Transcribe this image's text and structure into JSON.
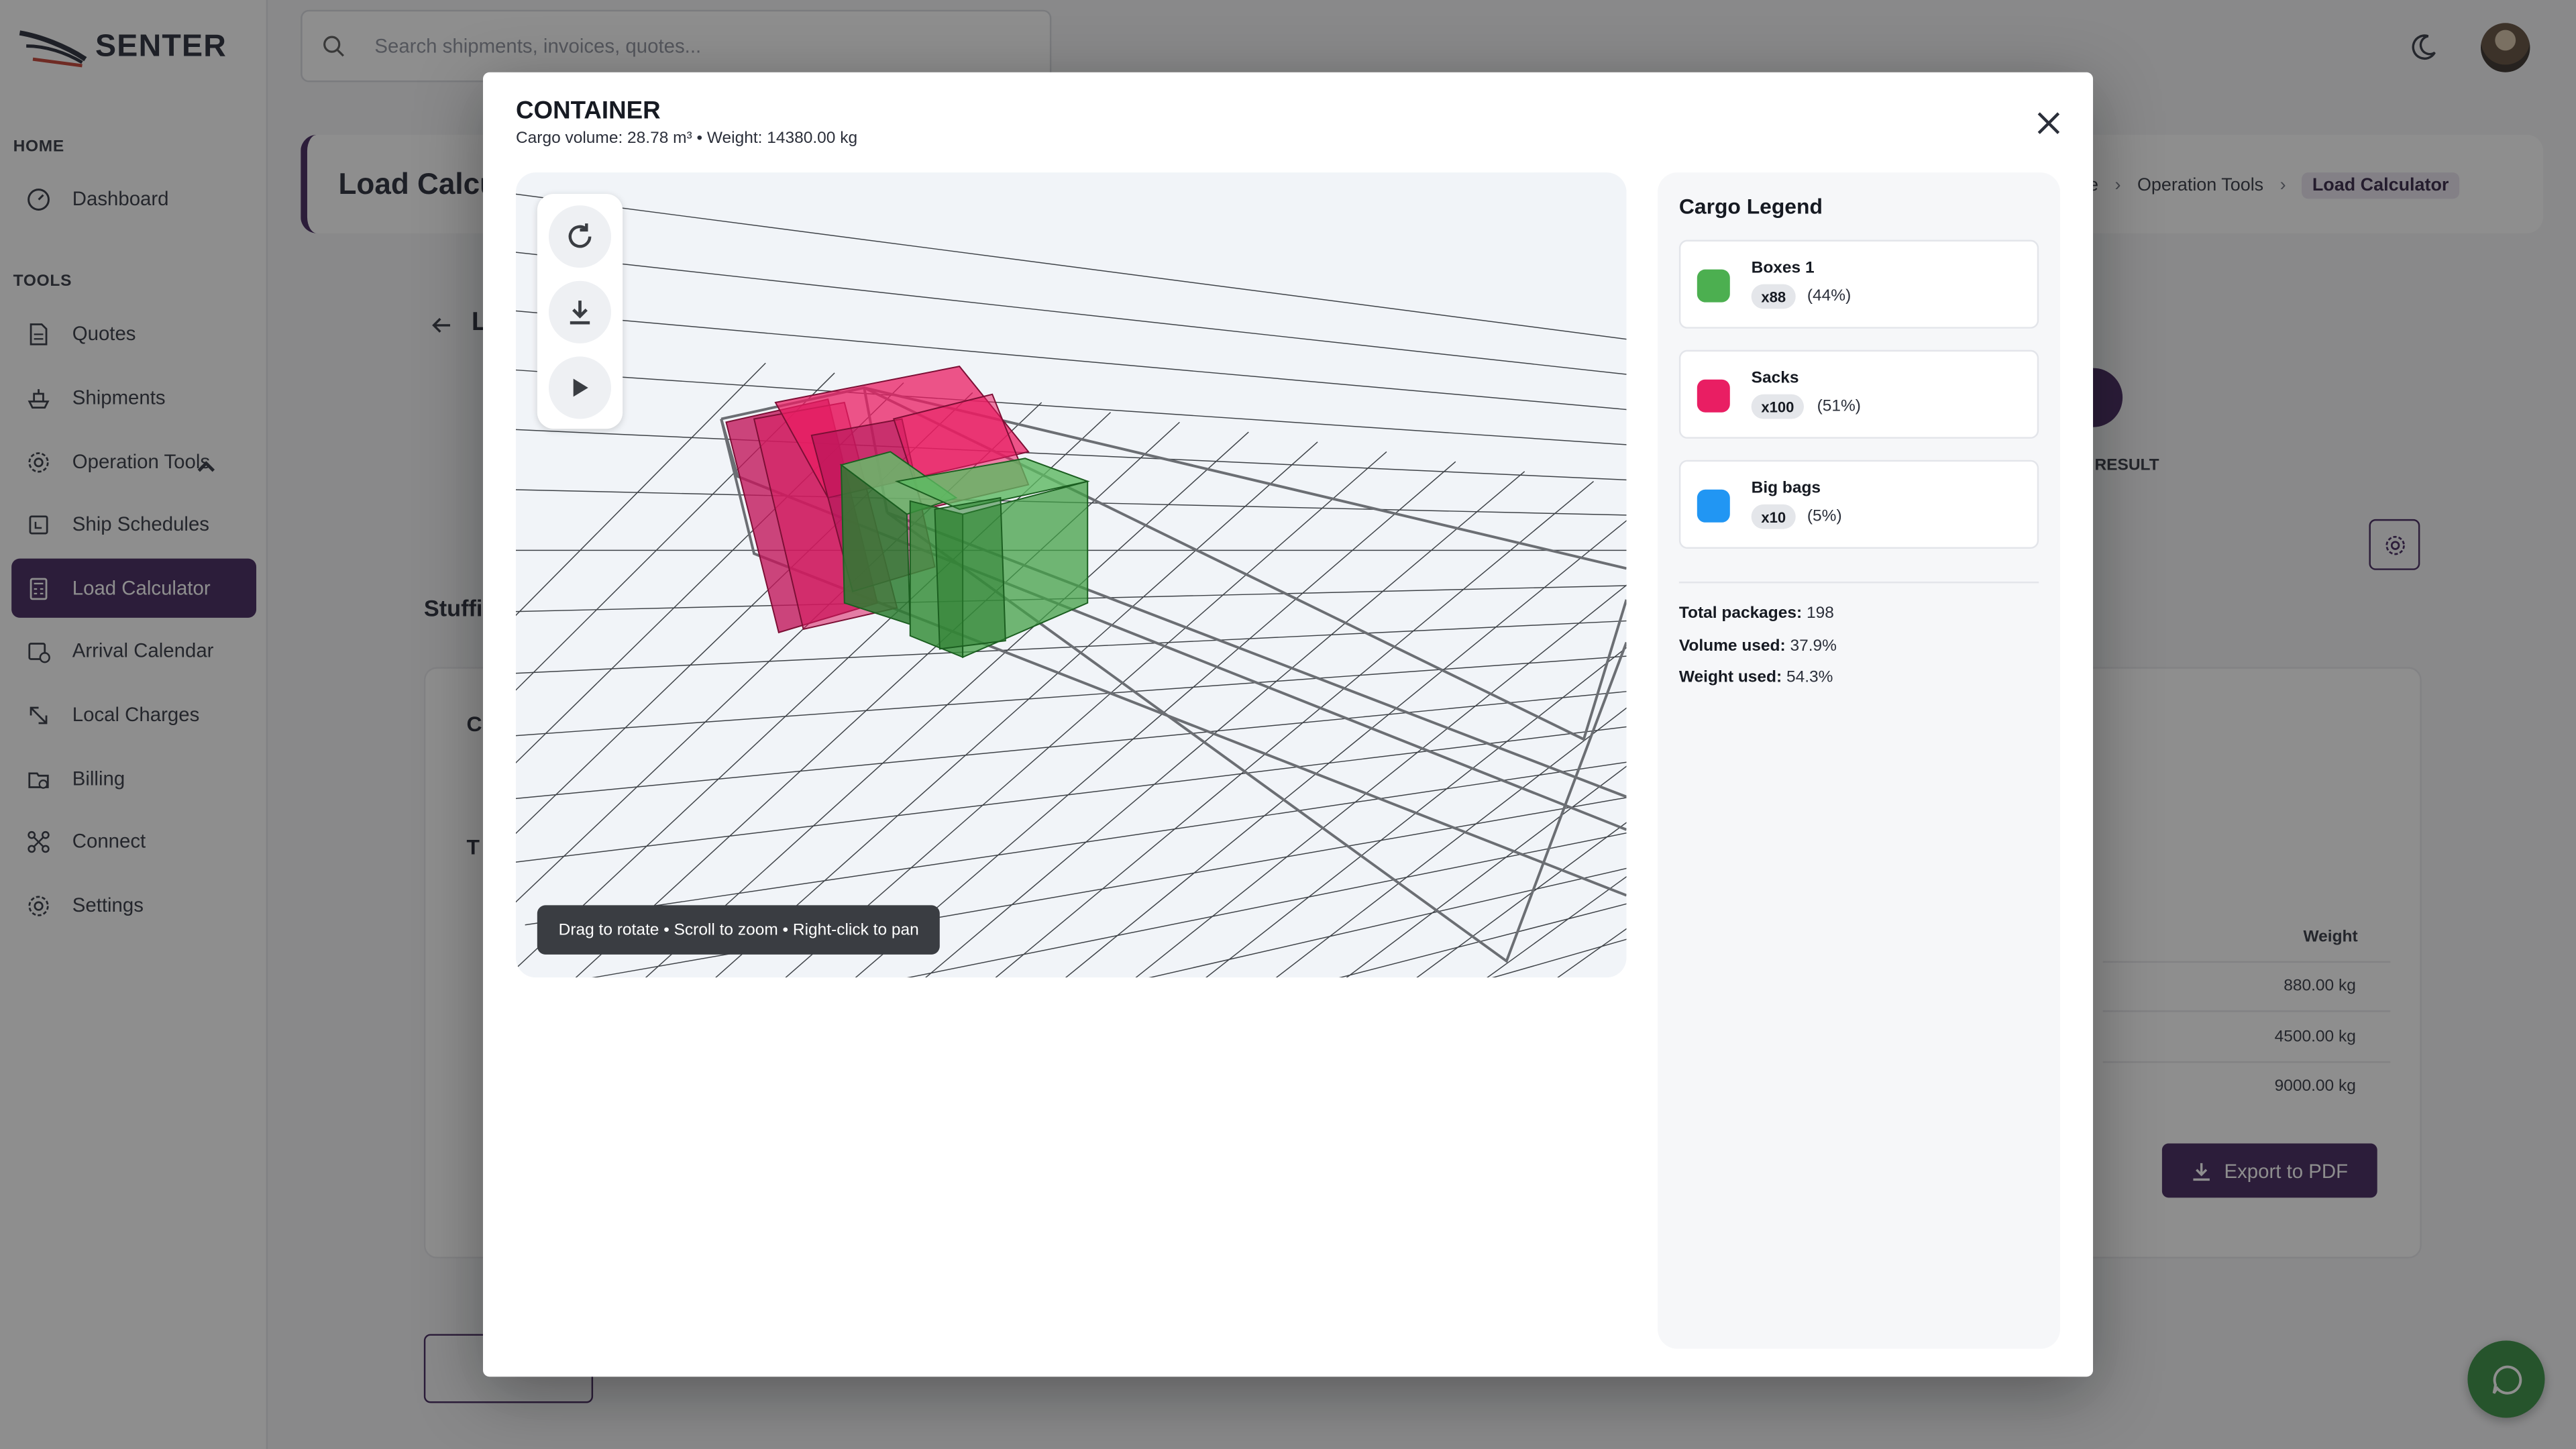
{
  "app": {
    "logo_text": "SENTER",
    "search_placeholder": "Search shipments, invoices, quotes..."
  },
  "sidebar": {
    "home_section": "HOME",
    "tools_section": "TOOLS",
    "items": [
      {
        "label": "Dashboard",
        "icon": "dashboard-icon"
      },
      {
        "label": "Quotes",
        "icon": "document-icon"
      },
      {
        "label": "Shipments",
        "icon": "ship-icon"
      },
      {
        "label": "Operation Tools",
        "icon": "gear-icon"
      },
      {
        "label": "Ship Schedules",
        "icon": "calendar-icon"
      },
      {
        "label": "Load Calculator",
        "icon": "calculator-icon"
      },
      {
        "label": "Arrival Calendar",
        "icon": "calendar-clock-icon"
      },
      {
        "label": "Local Charges",
        "icon": "charges-icon"
      },
      {
        "label": "Billing",
        "icon": "billing-icon"
      },
      {
        "label": "Connect",
        "icon": "connect-icon"
      },
      {
        "label": "Settings",
        "icon": "gear-icon"
      }
    ]
  },
  "page": {
    "title": "Load Calcu",
    "breadcrumbs": [
      "ne",
      "Operation Tools",
      "Load Calculator"
    ],
    "step_label": "RESULT",
    "stuffing_title": "Stuffi",
    "weight_header": "Weight",
    "weights": [
      "880.00 kg",
      "4500.00 kg",
      "9000.00 kg"
    ],
    "export_label": "Export to PDF"
  },
  "modal": {
    "title": "CONTAINER",
    "subtitle": "Cargo volume: 28.78 m³ • Weight: 14380.00 kg",
    "hint": "Drag to rotate • Scroll to zoom • Right-click to pan",
    "legend": {
      "title": "Cargo Legend",
      "items": [
        {
          "name": "Boxes 1",
          "count": "x88",
          "percent": "(44%)",
          "color": "#4caf50"
        },
        {
          "name": "Sacks",
          "count": "x100",
          "percent": "(51%)",
          "color": "#e91e63"
        },
        {
          "name": "Big bags",
          "count": "x10",
          "percent": "(5%)",
          "color": "#2196f3"
        }
      ],
      "stats": [
        {
          "label": "Total packages:",
          "value": "198"
        },
        {
          "label": "Volume used:",
          "value": "37.9%"
        },
        {
          "label": "Weight used:",
          "value": "54.3%"
        }
      ]
    }
  },
  "colors": {
    "brand": "#3b1d57",
    "chat": "#2e8b3a"
  }
}
